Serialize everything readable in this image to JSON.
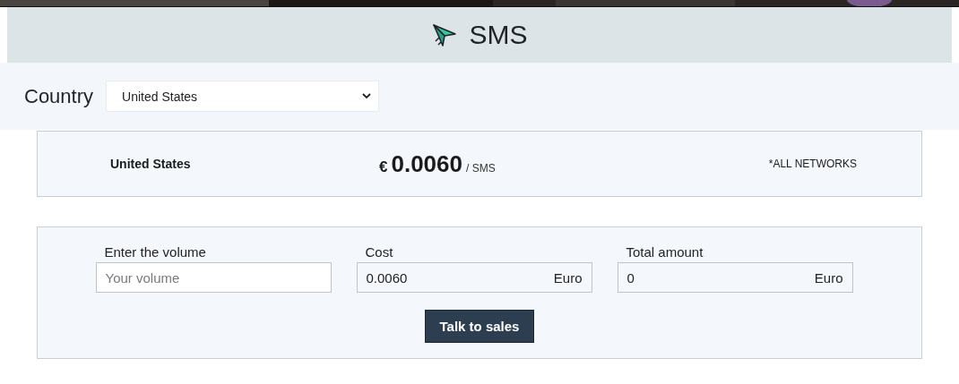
{
  "header": {
    "title": "SMS"
  },
  "country": {
    "label": "Country",
    "value": "United States"
  },
  "rate": {
    "country": "United States",
    "currency": "€",
    "price": "0.0060",
    "unit": "/ SMS",
    "note": "*ALL NETWORKS"
  },
  "calculator": {
    "fields": [
      {
        "kind": "input",
        "label": "Enter the volume",
        "placeholder": "Your volume"
      },
      {
        "kind": "readout",
        "label": "Cost",
        "value": "0.0060",
        "unit": "Euro"
      },
      {
        "kind": "readout",
        "label": "Total amount",
        "value": "0",
        "unit": "Euro"
      }
    ],
    "button": "Talk to sales"
  }
}
